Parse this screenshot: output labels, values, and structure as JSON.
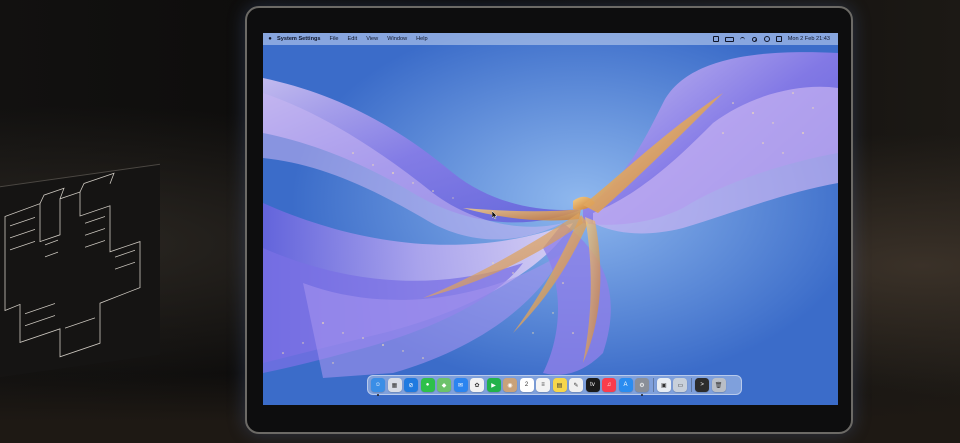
{
  "menubar": {
    "app_name": "System Settings",
    "menus": [
      "File",
      "Edit",
      "View",
      "Window",
      "Help"
    ],
    "datetime": "Mon 2 Feb  21:43"
  },
  "dock": {
    "apps": [
      {
        "name": "finder-icon",
        "color": "#3a8ee6",
        "glyph": "☺"
      },
      {
        "name": "launchpad-icon",
        "color": "#d9dde6",
        "glyph": "▦"
      },
      {
        "name": "safari-icon",
        "color": "#1f7ae0",
        "glyph": "⊘"
      },
      {
        "name": "messages-icon",
        "color": "#2ec04a",
        "glyph": "●"
      },
      {
        "name": "maps-icon",
        "color": "#6cc26a",
        "glyph": "◆"
      },
      {
        "name": "mail-icon",
        "color": "#2b84f0",
        "glyph": "✉"
      },
      {
        "name": "photos-icon",
        "color": "#f2f2f2",
        "glyph": "✿"
      },
      {
        "name": "facetime-icon",
        "color": "#22b24a",
        "glyph": "▶"
      },
      {
        "name": "contacts-icon",
        "color": "#c9a27a",
        "glyph": "◉"
      },
      {
        "name": "calendar-icon",
        "color": "#ffffff",
        "glyph": "2"
      },
      {
        "name": "reminders-icon",
        "color": "#f3f3f3",
        "glyph": "≡"
      },
      {
        "name": "notes-icon",
        "color": "#f7d64a",
        "glyph": "▤"
      },
      {
        "name": "freeform-icon",
        "color": "#f0f0f0",
        "glyph": "✎"
      },
      {
        "name": "apple-tv-icon",
        "color": "#1a1a1a",
        "glyph": "tv"
      },
      {
        "name": "music-icon",
        "color": "#fa3c4c",
        "glyph": "♫"
      },
      {
        "name": "app-store-icon",
        "color": "#2a8cf0",
        "glyph": "A"
      },
      {
        "name": "system-settings-icon",
        "color": "#8a8f98",
        "glyph": "⚙"
      }
    ],
    "recent": [
      {
        "name": "preview-icon",
        "color": "#e8edf3",
        "glyph": "▣"
      },
      {
        "name": "image-capture-icon",
        "color": "#c8d0da",
        "glyph": "▭"
      }
    ],
    "extras": [
      {
        "name": "terminal-icon",
        "color": "#2c2c2c",
        "glyph": ">"
      },
      {
        "name": "trash-icon",
        "color": "#b9bec6",
        "glyph": "🗑"
      }
    ]
  }
}
